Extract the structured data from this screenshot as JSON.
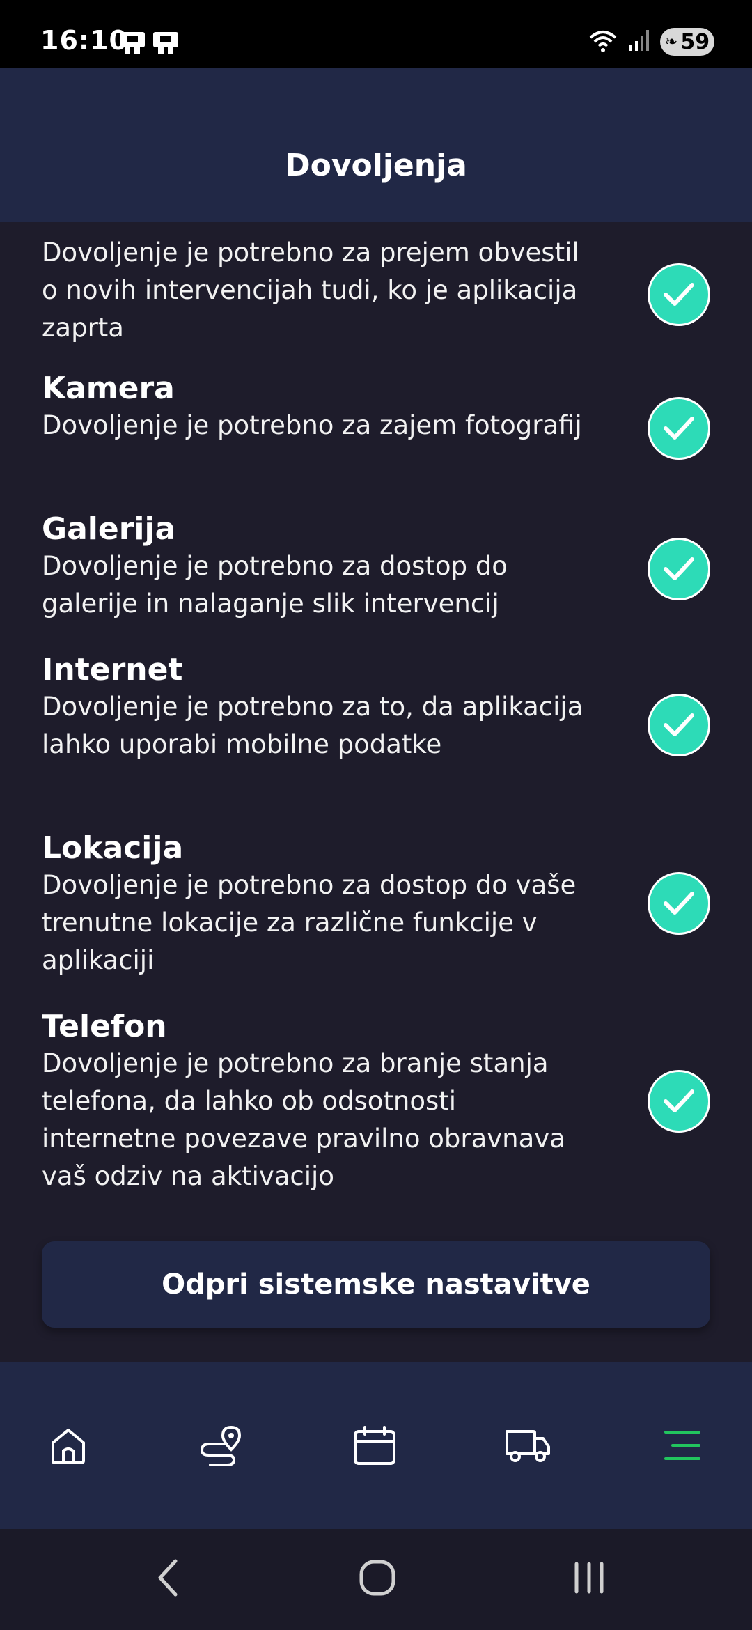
{
  "status_bar": {
    "time": "16:10",
    "battery": "59"
  },
  "header": {
    "title": "Dovoljenja"
  },
  "permissions": [
    {
      "title": "",
      "description": "Dovoljenje je potrebno za prejem obvestil o novih intervencijah tudi, ko je aplikacija zaprta",
      "granted": true
    },
    {
      "title": "Kamera",
      "description": "Dovoljenje je potrebno za zajem fotografij",
      "granted": true
    },
    {
      "title": "Galerija",
      "description": "Dovoljenje je potrebno za dostop do galerije in nalaganje slik intervencij",
      "granted": true
    },
    {
      "title": "Internet",
      "description": "Dovoljenje je potrebno za to, da aplikacija lahko uporabi mobilne podatke",
      "granted": true
    },
    {
      "title": "Lokacija",
      "description": "Dovoljenje je potrebno za dostop do vaše trenutne lokacije za različne funkcije v aplikaciji",
      "granted": true
    },
    {
      "title": "Telefon",
      "description": "Dovoljenje je potrebno za branje stanja telefona, da lahko ob odsotnosti internetne povezave pravilno obravnava vaš odziv na aktivacijo",
      "granted": true
    }
  ],
  "actions": {
    "open_settings_label": "Odpri sistemske nastavitve"
  },
  "bottom_nav": {
    "items": [
      {
        "icon": "home-icon",
        "active": false
      },
      {
        "icon": "route-icon",
        "active": false
      },
      {
        "icon": "calendar-icon",
        "active": false
      },
      {
        "icon": "truck-icon",
        "active": false
      },
      {
        "icon": "menu-icon",
        "active": true
      }
    ]
  },
  "colors": {
    "background": "#1e1c2b",
    "header": "#212846",
    "check_accent": "#2ddbb7",
    "active_nav": "#22c55e",
    "inactive_nav": "#ffffff"
  }
}
